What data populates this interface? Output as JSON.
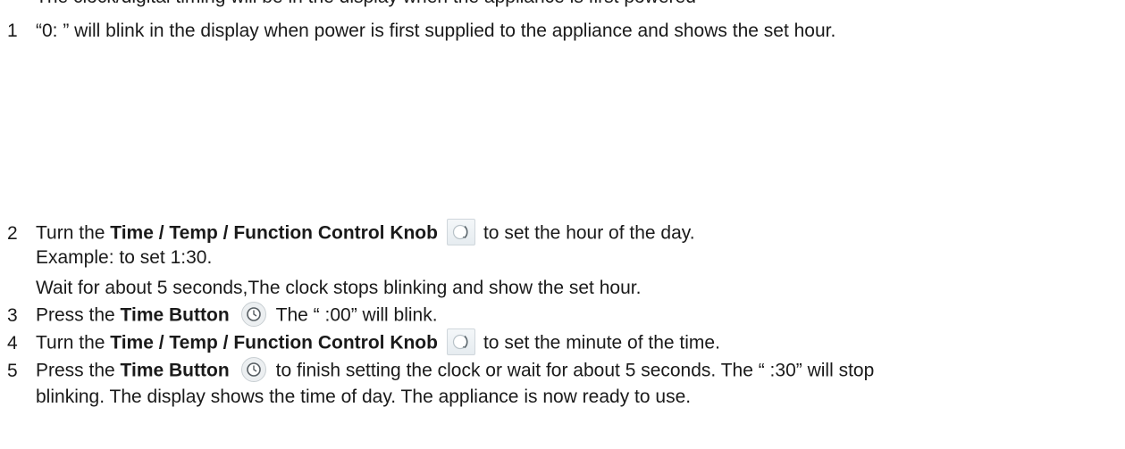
{
  "top_partial": "The clock/digital timing will be in the display when the appliance is first powered",
  "steps": [
    {
      "num": "1",
      "text_a": "“0:   ” will blink in the display when power is first supplied to the appliance and shows the set hour."
    },
    {
      "num": "2",
      "text_a": "Turn the ",
      "bold": "Time / Temp / Function Control Knob",
      "text_b": "to set the hour of the day.",
      "sub1": "Example: to set 1:30.",
      "sub2": "Wait for about 5 seconds,The clock stops blinking and show the set hour."
    },
    {
      "num": "3",
      "text_a": "Press the ",
      "bold": "Time Button",
      "text_b": "The “   :00” will blink."
    },
    {
      "num": "4",
      "text_a": "Turn the ",
      "bold": "Time / Temp / Function Control Knob",
      "text_b": "to set the minute of the time."
    },
    {
      "num": "5",
      "text_a": "Press the ",
      "bold": "Time Button",
      "text_b": "to finish setting the clock or wait for about 5 seconds. The “   :30” will stop",
      "cont": "blinking. The display shows the time of day. The appliance is now ready to use."
    }
  ],
  "icons": {
    "knob": "control-knob-icon",
    "button": "time-button-icon"
  }
}
